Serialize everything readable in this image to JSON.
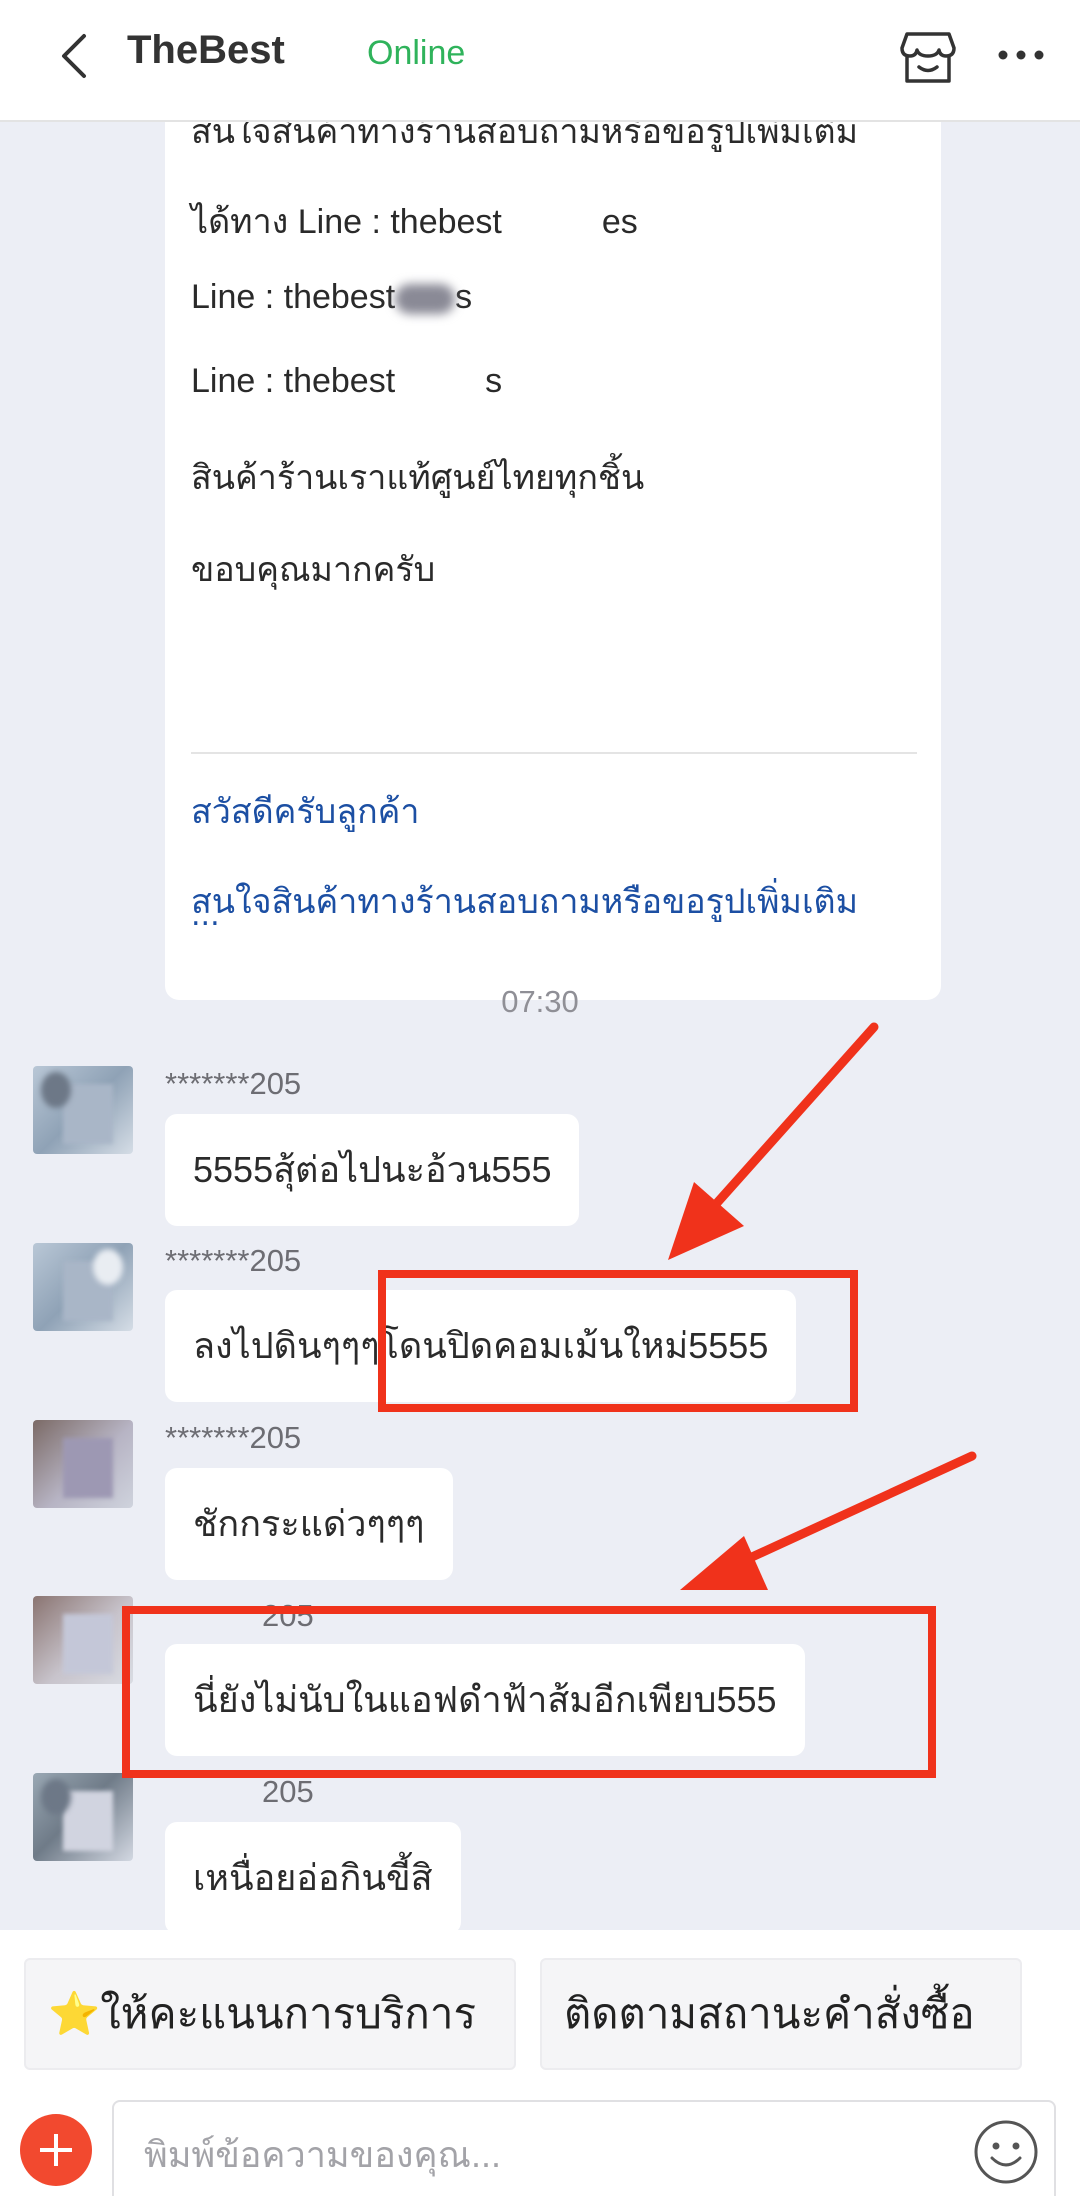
{
  "header": {
    "title": "TheBest",
    "status": "Online"
  },
  "card": {
    "lines": [
      "สนใจสินค้าทางร้านสอบถามหรือขอรูปเพิ่มเติม",
      "ได้ทาง Line : thebest",
      "Line : thebest",
      "Line : thebest",
      "สินค้าร้านเราแท้ศูนย์ไทยทุกชิ้น",
      "ขอบคุณมากครับ"
    ],
    "line_suffix": "es",
    "line_suffix_b": "s",
    "links": [
      "สวัสดีครับลูกค้า",
      "สนใจสินค้าทางร้านสอบถามหรือขอรูปเพิ่มเติม"
    ],
    "ellipsis": "..."
  },
  "timestamp": "07:30",
  "messages": [
    {
      "sender": "*******205",
      "text": "5555สุ้ต่อไปนะอ้วน555"
    },
    {
      "sender": "*******205",
      "text": "ลงไปดินๆๆๆโดนปิดคอมเม้นใหม่5555"
    },
    {
      "sender": "*******205",
      "text": "ชักกระแด่วๆๆๆ"
    },
    {
      "sender": "205",
      "text": "นี่ยังไม่นับในแอฟดำฟ้าส้มอีกเพียบ555"
    },
    {
      "sender": "205",
      "text": "เหนื่อยอ่อกินขี้สิ"
    }
  ],
  "quick_replies": [
    {
      "icon": "⭐",
      "label": "ให้คะแนนการบริการ"
    },
    {
      "label": "ติดตามสถานะคำสั่งซื้อ"
    }
  ],
  "input": {
    "placeholder": "พิมพ์ข้อความของคุณ..."
  },
  "colors": {
    "accent": "#f2492f",
    "online": "#2fb35b",
    "link": "#1c4fa3",
    "annotation": "#f0321b"
  }
}
